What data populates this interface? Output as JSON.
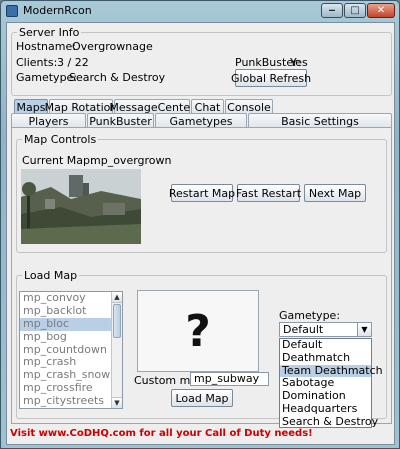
{
  "window": {
    "title": "ModernRcon"
  },
  "server_info": {
    "legend": "Server Info",
    "hostname_label": "Hostname:",
    "hostname_value": "Overgrownage",
    "clients_label": "Clients:",
    "clients_value": "3 / 22",
    "gametype_label": "Gametype:",
    "gametype_value": "Search & Destroy",
    "punkbuster_label": "PunkBuster:",
    "punkbuster_value": "Yes",
    "refresh_button": "Global Refresh"
  },
  "tabs_row1": [
    "Maps",
    "Map Rotation",
    "MessageCenter",
    "Chat",
    "Console"
  ],
  "tabs_row2": [
    "Players",
    "PunkBuster",
    "Gametypes",
    "Basic Settings"
  ],
  "active_tab": "Maps",
  "map_controls": {
    "legend": "Map Controls",
    "current_map_label": "Current Map:",
    "current_map_value": "mp_overgrown",
    "restart_button": "Restart Map",
    "fast_restart_button": "Fast Restart",
    "next_map_button": "Next Map"
  },
  "load_map": {
    "legend": "Load Map",
    "maps": [
      "mp_convoy",
      "mp_backlot",
      "mp_bloc",
      "mp_bog",
      "mp_countdown",
      "mp_crash",
      "mp_crash_snow",
      "mp_crossfire",
      "mp_citystreets"
    ],
    "selected_map": "mp_bloc",
    "preview_placeholder": "?",
    "custom_map_label": "Custom map:",
    "custom_map_value": "mp_subway",
    "load_button": "Load Map",
    "gametype_label": "Gametype:",
    "gametype_selected": "Default",
    "gametype_options": [
      "Default",
      "Deathmatch",
      "Team Deathmatch",
      "Sabotage",
      "Domination",
      "Headquarters",
      "Search & Destroy"
    ],
    "highlighted_option": "Team Deathmatch"
  },
  "footer": {
    "text": "Visit www.CoDHQ.com for all your Call of Duty needs!"
  },
  "colors": {
    "footer_text": "#cc0000",
    "selection": "#b8cfe6"
  }
}
